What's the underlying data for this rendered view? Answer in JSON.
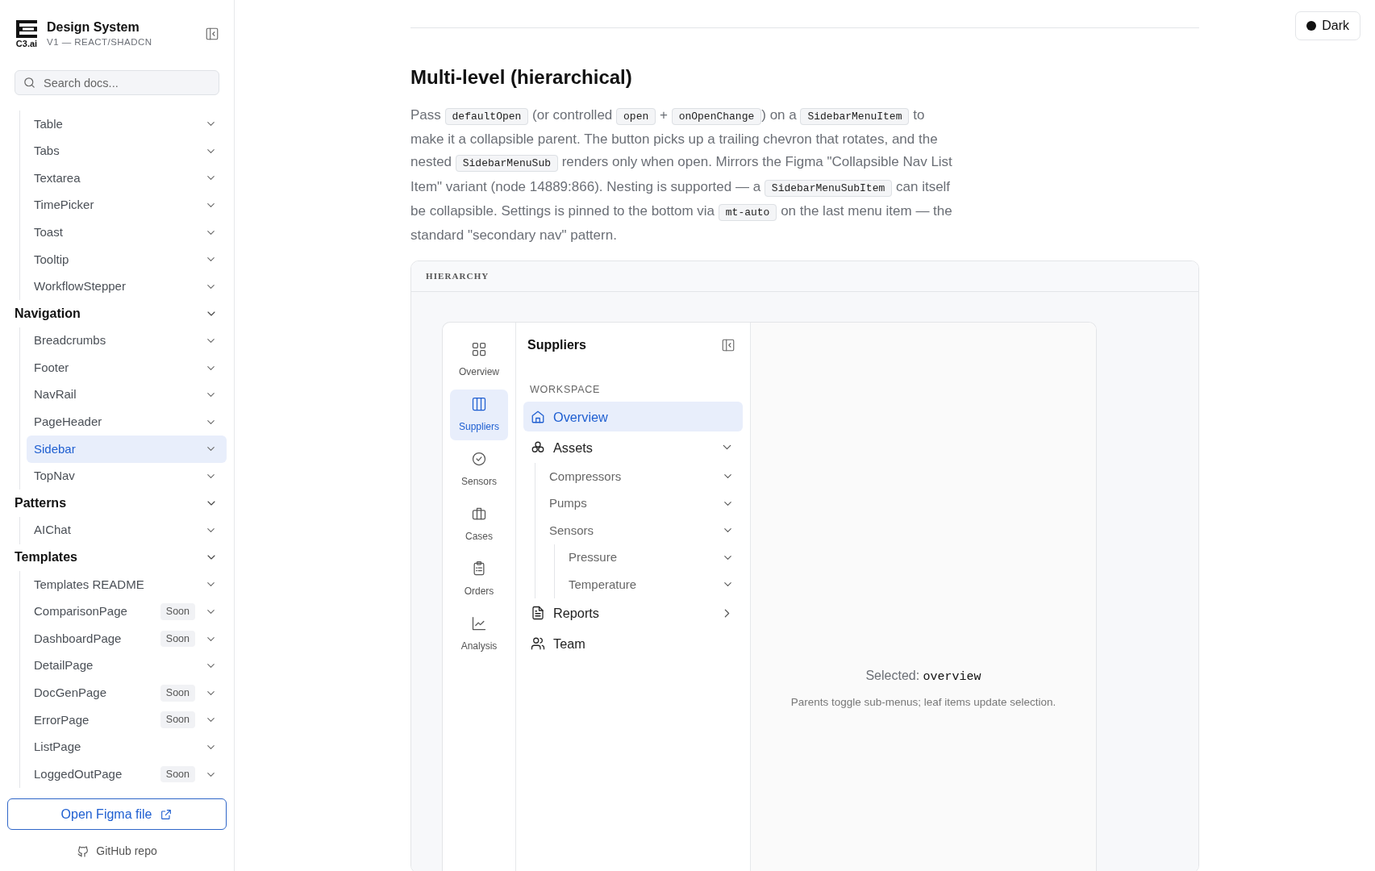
{
  "sidebar": {
    "brand": {
      "logo_text": "C3.ai",
      "title": "Design System",
      "subtitle": "V1 — REACT/SHADCN"
    },
    "search": {
      "placeholder": "Search docs..."
    },
    "sections": [
      {
        "items": [
          {
            "label": "Table",
            "selected": false
          },
          {
            "label": "Tabs",
            "selected": false
          },
          {
            "label": "Textarea",
            "selected": false
          },
          {
            "label": "TimePicker",
            "selected": false
          },
          {
            "label": "Toast",
            "selected": false
          },
          {
            "label": "Tooltip",
            "selected": false
          },
          {
            "label": "WorkflowStepper",
            "selected": false
          }
        ]
      },
      {
        "title": "Navigation",
        "expanded": true,
        "items": [
          {
            "label": "Breadcrumbs",
            "selected": false
          },
          {
            "label": "Footer",
            "selected": false
          },
          {
            "label": "NavRail",
            "selected": false
          },
          {
            "label": "PageHeader",
            "selected": false
          },
          {
            "label": "Sidebar",
            "selected": true
          },
          {
            "label": "TopNav",
            "selected": false
          }
        ]
      },
      {
        "title": "Patterns",
        "expanded": true,
        "items": [
          {
            "label": "AIChat",
            "selected": false
          }
        ]
      },
      {
        "title": "Templates",
        "expanded": true,
        "items": [
          {
            "label": "Templates README",
            "selected": false
          },
          {
            "label": "ComparisonPage",
            "selected": false,
            "badge": "Soon"
          },
          {
            "label": "DashboardPage",
            "selected": false,
            "badge": "Soon"
          },
          {
            "label": "DetailPage",
            "selected": false
          },
          {
            "label": "DocGenPage",
            "selected": false,
            "badge": "Soon"
          },
          {
            "label": "ErrorPage",
            "selected": false,
            "badge": "Soon"
          },
          {
            "label": "ListPage",
            "selected": false
          },
          {
            "label": "LoggedOutPage",
            "selected": false,
            "badge": "Soon"
          }
        ]
      }
    ],
    "figma_button": "Open Figma file",
    "github_link": "GitHub repo"
  },
  "theme_toggle": {
    "label": "Dark"
  },
  "article": {
    "heading": "Multi-level (hierarchical)",
    "paragraph": [
      {
        "kind": "text",
        "text": "Pass "
      },
      {
        "kind": "code",
        "text": "defaultOpen"
      },
      {
        "kind": "text",
        "text": " (or controlled "
      },
      {
        "kind": "code",
        "text": "open"
      },
      {
        "kind": "text",
        "text": " + "
      },
      {
        "kind": "code",
        "text": "onOpenChange"
      },
      {
        "kind": "text",
        "text": ") on a "
      },
      {
        "kind": "code",
        "text": "SidebarMenuItem"
      },
      {
        "kind": "text",
        "text": " to make it a collapsible parent. The button picks up a trailing chevron that rotates, and the nested "
      },
      {
        "kind": "code",
        "text": "SidebarMenuSub"
      },
      {
        "kind": "text",
        "text": " renders only when open. Mirrors the Figma \"Collapsible Nav List Item\" variant (node 14889:866). Nesting is supported — a "
      },
      {
        "kind": "code",
        "text": "SidebarMenuSubItem"
      },
      {
        "kind": "text",
        "text": " can itself be collapsible. Settings is pinned to the bottom via "
      },
      {
        "kind": "code",
        "text": "mt-auto"
      },
      {
        "kind": "text",
        "text": " on the last menu item — the standard \"secondary nav\" pattern."
      }
    ]
  },
  "demo": {
    "header": "HIERARCHY",
    "rail": [
      {
        "label": "Overview",
        "selected": false
      },
      {
        "label": "Suppliers",
        "selected": true
      },
      {
        "label": "Sensors",
        "selected": false
      },
      {
        "label": "Cases",
        "selected": false
      },
      {
        "label": "Orders",
        "selected": false
      },
      {
        "label": "Analysis",
        "selected": false
      }
    ],
    "panel": {
      "title": "Suppliers",
      "group_label": "WORKSPACE",
      "items": [
        {
          "label": "Overview",
          "selected": true
        },
        {
          "label": "Assets",
          "selected": false,
          "expanded": true,
          "children": [
            {
              "label": "Compressors",
              "selected": false,
              "expanded": true
            },
            {
              "label": "Pumps",
              "selected": false,
              "expanded": true
            },
            {
              "label": "Sensors",
              "selected": false,
              "expanded": true,
              "children": [
                {
                  "label": "Pressure",
                  "selected": false,
                  "expanded": true
                },
                {
                  "label": "Temperature",
                  "selected": false,
                  "expanded": true
                }
              ]
            }
          ]
        },
        {
          "label": "Reports",
          "selected": false,
          "expanded": false
        },
        {
          "label": "Team",
          "selected": false
        }
      ]
    },
    "content": {
      "selected_label": "Selected:",
      "selected_value": "overview",
      "note": "Parents toggle sub-menus; leaf items update selection."
    }
  }
}
